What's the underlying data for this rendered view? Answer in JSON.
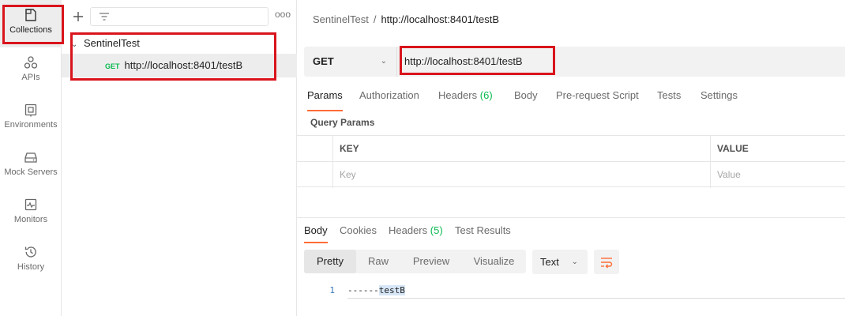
{
  "rail": {
    "items": [
      {
        "label": "Collections",
        "icon": "collections-icon"
      },
      {
        "label": "APIs",
        "icon": "apis-icon"
      },
      {
        "label": "Environments",
        "icon": "environments-icon"
      },
      {
        "label": "Mock Servers",
        "icon": "mock-servers-icon"
      },
      {
        "label": "Monitors",
        "icon": "monitors-icon"
      },
      {
        "label": "History",
        "icon": "history-icon"
      }
    ]
  },
  "sidebar": {
    "more": "ooo",
    "collection": {
      "name": "SentinelTest"
    },
    "request": {
      "method": "GET",
      "url": "http://localhost:8401/testB"
    }
  },
  "header": {
    "breadcrumb_parent": "SentinelTest",
    "breadcrumb_sep": "/",
    "breadcrumb_current": "http://localhost:8401/testB"
  },
  "request": {
    "method": "GET",
    "url": "http://localhost:8401/testB",
    "tabs": [
      {
        "label": "Params"
      },
      {
        "label": "Authorization"
      },
      {
        "label": "Headers",
        "count": "(6)"
      },
      {
        "label": "Body"
      },
      {
        "label": "Pre-request Script"
      },
      {
        "label": "Tests"
      },
      {
        "label": "Settings"
      }
    ],
    "query_params_title": "Query Params",
    "table": {
      "headers": [
        "KEY",
        "VALUE"
      ],
      "placeholders": [
        "Key",
        "Value"
      ]
    }
  },
  "response": {
    "tabs": [
      {
        "label": "Body"
      },
      {
        "label": "Cookies"
      },
      {
        "label": "Headers",
        "count": "(5)"
      },
      {
        "label": "Test Results"
      }
    ],
    "formats": [
      "Pretty",
      "Raw",
      "Preview",
      "Visualize"
    ],
    "type": "Text",
    "line_number": "1",
    "body_prefix": "------",
    "body_highlight": "testB"
  },
  "colors": {
    "accent": "#ff6c37",
    "method_get": "#0cbb52",
    "annotation": "#d9141c"
  }
}
